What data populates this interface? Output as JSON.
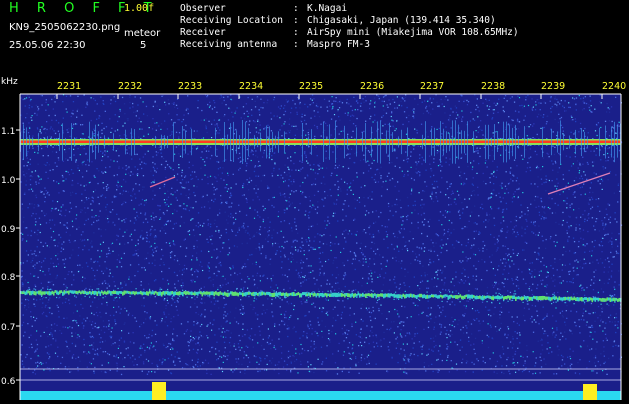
{
  "header": {
    "app_title": "H R O F F T",
    "version": "1.00f",
    "filename": "KN9_2505062230.png",
    "mode": "meteor",
    "datetime": "25.05.06 22:30",
    "count": "5"
  },
  "info": [
    {
      "key": "Observer",
      "value": "K.Nagai"
    },
    {
      "key": "Receiving Location",
      "value": "Chigasaki, Japan (139.414 35.340)"
    },
    {
      "key": "Receiver",
      "value": "AirSpy mini (Miakejima VOR 108.65MHz)"
    },
    {
      "key": "Receiving antenna",
      "value": "Maspro FM-3"
    }
  ],
  "colors": {
    "title": "#22ff22",
    "version": "#ffff33",
    "time_labels": "#ffff33",
    "axis": "#ffffff",
    "background": "#1a1f8a"
  },
  "spectrogram": {
    "y_unit": "kHz",
    "y_ticks": [
      "1.1",
      "1.0",
      "0.9",
      "0.8",
      "0.7",
      "0.6"
    ],
    "time_labels": [
      "2231",
      "2232",
      "2233",
      "2234",
      "2235",
      "2236",
      "2237",
      "2238",
      "2239",
      "2240"
    ]
  }
}
